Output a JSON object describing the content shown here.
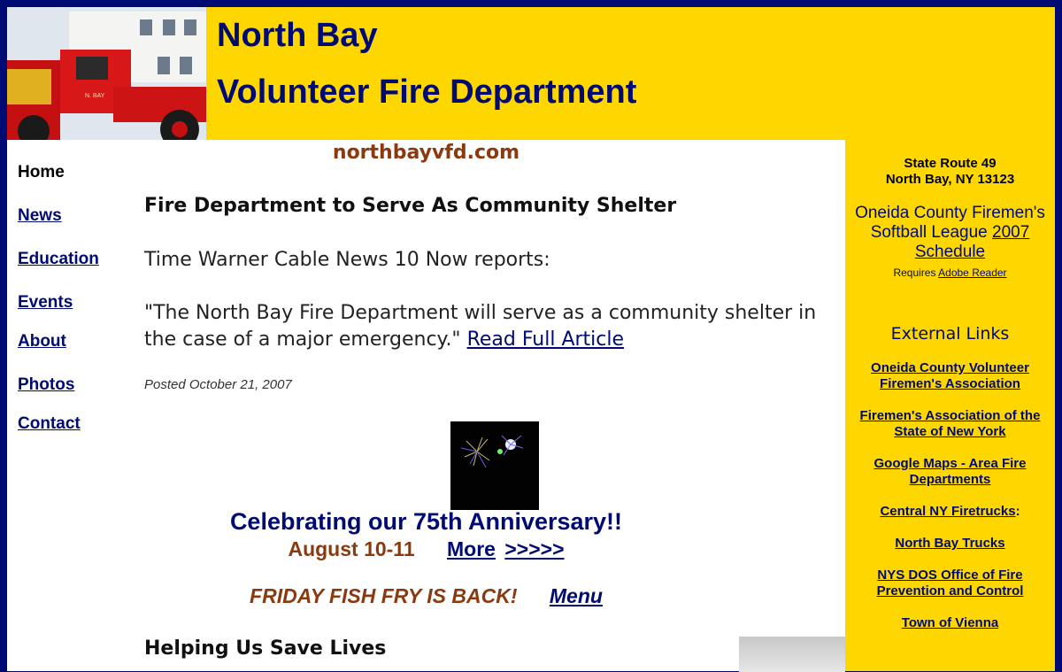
{
  "header": {
    "title_line1": "North Bay",
    "title_line2": "Volunteer Fire Department",
    "truck_label": "N. BAY"
  },
  "nav": {
    "home": "Home",
    "news": "News",
    "education": "Education",
    "events": "Events",
    "about": "About",
    "photos": "Photos",
    "contact": "Contact"
  },
  "main": {
    "domain": "northbayvfd.com",
    "headline": "Fire Department to Serve As Community Shelter",
    "report": "Time Warner Cable News 10 Now reports:",
    "quote": "\"The North Bay Fire Department will serve as a community shelter in the case of a major emergency.\"",
    "read_more": "Read Full Article",
    "posted": "Posted October 21, 2007",
    "anniversary": "Celebrating our 75th Anniversary!!",
    "anniversary_date": "August 10-11",
    "more": "More",
    "more_arrows": ">>>>>",
    "fish_fry": "FRIDAY FISH FRY IS BACK!",
    "menu": "Menu",
    "helping": "Helping Us Save Lives"
  },
  "sidebar": {
    "address_line1": "State Route 49",
    "address_line2": "North Bay, NY 13123",
    "softball_text": "Oneida County Firemen's Softball League",
    "softball_link": "2007 Schedule",
    "requires_text": "Requires",
    "requires_link": "Adobe Reader",
    "external_title": "External Links",
    "links": [
      "Oneida County Volunteer Firemen's Association",
      "Firemen's Association of the State of New York",
      "Google Maps - Area Fire Departments",
      "Central NY Firetrucks",
      "North Bay Trucks",
      "NYS DOS Office of Fire Prevention and Control",
      "Town of Vienna"
    ],
    "colon": ":"
  },
  "colors": {
    "navy": "#000a73",
    "gold": "#ffd700",
    "brown": "#8b3a0f"
  }
}
